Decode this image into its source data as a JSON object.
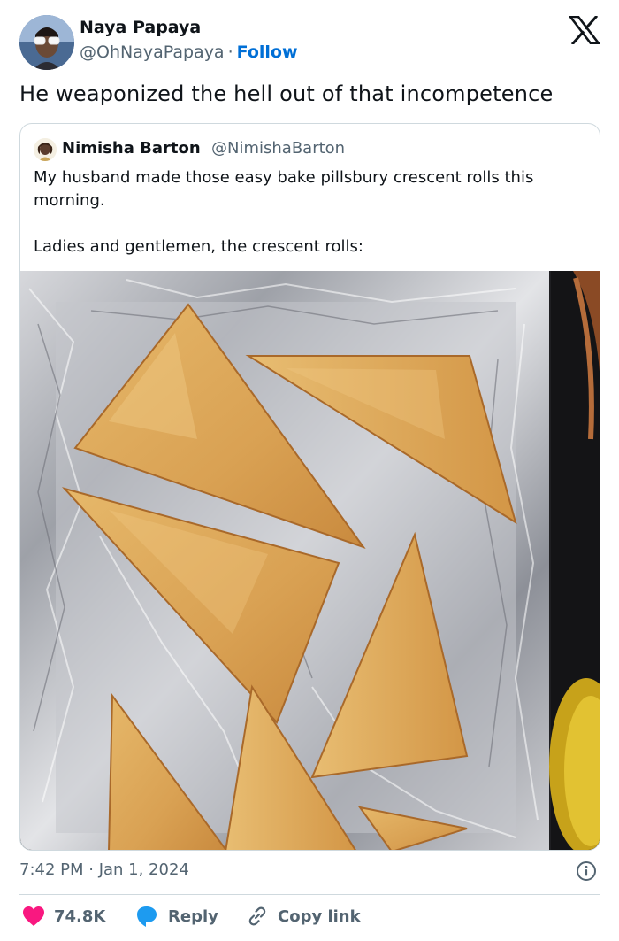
{
  "author": {
    "name": "Naya Papaya",
    "handle": "@OhNayaPapaya",
    "separator": "·",
    "follow_label": "Follow"
  },
  "tweet": {
    "text": "He weaponized the hell out of that incompetence"
  },
  "quoted": {
    "name": "Nimisha Barton",
    "handle": "@NimishaBarton",
    "paragraphs": [
      "My husband made those easy bake pillsbury crescent rolls this morning.",
      "Ladies and gentlemen, the crescent rolls:"
    ],
    "photo_alt": "crescent-rolls-photo"
  },
  "footer": {
    "timestamp": "7:42 PM · Jan 1, 2024",
    "like_count": "74.8K",
    "reply_label": "Reply",
    "copy_label": "Copy link"
  },
  "colors": {
    "text": "#0f1419",
    "secondary": "#536471",
    "link": "#006fd6",
    "like": "#f91880",
    "reply": "#1d9bf0",
    "border": "#cfd9de"
  },
  "icons": [
    "x-logo-icon",
    "info-icon",
    "heart-icon",
    "reply-bubble-icon",
    "link-icon"
  ]
}
